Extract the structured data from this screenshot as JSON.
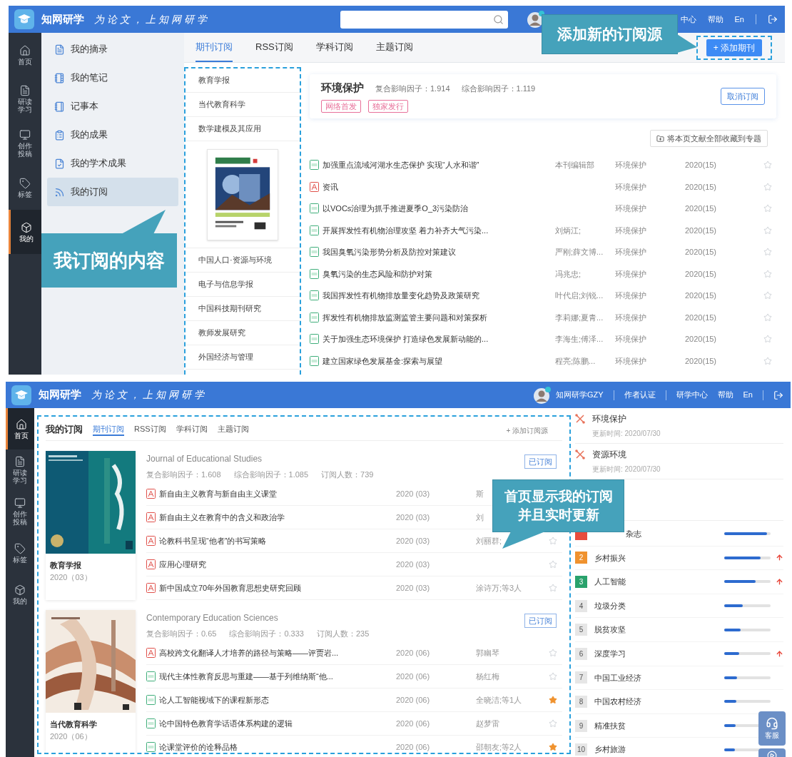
{
  "top_screen": {
    "header": {
      "brand": "知网研学",
      "slogan": "为论文，上知网研学",
      "links": [
        "中心",
        "帮助",
        "En"
      ]
    },
    "nav": [
      {
        "label": "首页",
        "selected": false
      },
      {
        "label": "研读学习",
        "selected": false
      },
      {
        "label": "创作投稿",
        "selected": false
      },
      {
        "label": "标签",
        "selected": false
      },
      {
        "label": "我的",
        "selected": true
      }
    ],
    "menu": [
      {
        "label": "我的摘录",
        "selected": false
      },
      {
        "label": "我的笔记",
        "selected": false
      },
      {
        "label": "记事本",
        "selected": false
      },
      {
        "label": "我的成果",
        "selected": false
      },
      {
        "label": "我的学术成果",
        "selected": false
      },
      {
        "label": "我的订阅",
        "selected": true
      }
    ],
    "tabs": [
      {
        "label": "期刊订阅",
        "selected": true
      },
      {
        "label": "RSS订阅",
        "selected": false
      },
      {
        "label": "学科订阅",
        "selected": false
      },
      {
        "label": "主题订阅",
        "selected": false
      }
    ],
    "add_button": "+ 添加期刊",
    "journals": [
      {
        "kind": "name",
        "name": "教育学报"
      },
      {
        "kind": "name",
        "name": "当代教育科学"
      },
      {
        "kind": "name",
        "name": "数学建模及其应用"
      },
      {
        "kind": "picture"
      },
      {
        "kind": "name",
        "name": "中国人口·资源与环境"
      },
      {
        "kind": "name",
        "name": "电子与信息学报"
      },
      {
        "kind": "name",
        "name": "中国科技期刊研究"
      },
      {
        "kind": "name",
        "name": "教师发展研究"
      },
      {
        "kind": "name",
        "name": "外国经济与管理"
      }
    ],
    "detail": {
      "title": "环境保护",
      "metrics": [
        "复合影响因子：1.914",
        "综合影响因子：1.119"
      ],
      "tags": [
        "网络首发",
        "独家发行"
      ],
      "button": "取消订阅"
    },
    "collect_button": "将本页文献全部收藏到专题",
    "articles": [
      {
        "kind": "html",
        "title": "加强重点流域河湖水生态保护 实现“人水和谐”",
        "author": "本刊编辑部",
        "journal": "环境保护",
        "issue": "2020(15)",
        "starred": false
      },
      {
        "kind": "pdf",
        "title": "资讯",
        "journal": "环境保护",
        "issue": "2020(15)",
        "starred": false
      },
      {
        "kind": "html",
        "title": "以VOCs治理为抓手推进夏季O_3污染防治",
        "journal": "环境保护",
        "issue": "2020(15)",
        "starred": false
      },
      {
        "kind": "html",
        "title": "开展挥发性有机物治理攻坚 着力补齐大气污染...",
        "author": "刘炳江;",
        "journal": "环境保护",
        "issue": "2020(15)",
        "starred": false
      },
      {
        "kind": "html",
        "title": "我国臭氧污染形势分析及防控对策建议",
        "author": "严刚;薛文博...",
        "journal": "环境保护",
        "issue": "2020(15)",
        "starred": false
      },
      {
        "kind": "html",
        "title": "臭氧污染的生态风险和防护对策",
        "author": "冯兆忠;",
        "journal": "环境保护",
        "issue": "2020(15)",
        "starred": false
      },
      {
        "kind": "html",
        "title": "我国挥发性有机物排放量变化趋势及政策研究",
        "author": "叶代启;刘锐...",
        "journal": "环境保护",
        "issue": "2020(15)",
        "starred": false
      },
      {
        "kind": "html",
        "title": "挥发性有机物排放监测监管主要问题和对策探析",
        "author": "李莉娜;夏青...",
        "journal": "环境保护",
        "issue": "2020(15)",
        "starred": false
      },
      {
        "kind": "html",
        "title": "关于加强生态环境保护 打造绿色发展新动能的...",
        "author": "李海生;傅泽...",
        "journal": "环境保护",
        "issue": "2020(15)",
        "starred": false
      },
      {
        "kind": "html",
        "title": "建立国家绿色发展基金:探索与展望",
        "author": "程亮;陈鹏...",
        "journal": "环境保护",
        "issue": "2020(15)",
        "starred": false
      }
    ],
    "callouts": [
      "添加新的订阅源",
      "我订阅的内容"
    ]
  },
  "bottom_screen": {
    "header": {
      "brand": "知网研学",
      "slogan": "为论文，上知网研学",
      "user": "知网研学GZY",
      "links": [
        "作者认证",
        "研学中心",
        "帮助",
        "En"
      ]
    },
    "nav": [
      {
        "label": "首页",
        "selected": true
      },
      {
        "label": "研读学习",
        "selected": false
      },
      {
        "label": "创作投稿",
        "selected": false
      },
      {
        "label": "标签",
        "selected": false
      },
      {
        "label": "我的",
        "selected": false
      }
    ],
    "panel": {
      "title": "我的订阅",
      "tabs": [
        {
          "label": "期刊订阅",
          "selected": true
        },
        {
          "label": "RSS订阅",
          "selected": false
        },
        {
          "label": "学科订阅",
          "selected": false
        },
        {
          "label": "主题订阅",
          "selected": false
        }
      ],
      "add_link": "+ 添加订阅源",
      "journals": [
        {
          "name": "教育学报",
          "issue": "2020（03）",
          "title": "Journal of Educational Studies",
          "metrics": [
            "复合影响因子：1.608",
            "综合影响因子：1.085",
            "订阅人数：739"
          ],
          "button": "已订阅",
          "articles": [
            {
              "kind": "pdf",
              "title": "新自由主义教育与新自由主义课堂",
              "issue": "2020 (03)",
              "author": "斯"
            },
            {
              "kind": "pdf",
              "title": "新自由主义在教育中的含义和政治学",
              "issue": "2020 (03)",
              "author": "刘"
            },
            {
              "kind": "pdf",
              "title": "论教科书呈现“他者”的书写策略",
              "issue": "2020 (03)",
              "author": "刘丽群;",
              "starred": false
            },
            {
              "kind": "pdf",
              "title": "应用心理研究",
              "issue": "2020 (03)",
              "starred": false
            },
            {
              "kind": "pdf",
              "title": "新中国成立70年外国教育思想史研究回顾",
              "issue": "2020 (03)",
              "author": "涂诗万;等3人",
              "starred": false
            }
          ]
        },
        {
          "name": "当代教育科学",
          "issue": "2020（06）",
          "title": "Contemporary Education Sciences",
          "metrics": [
            "复合影响因子：0.65",
            "综合影响因子：0.333",
            "订阅人数：235"
          ],
          "button": "已订阅",
          "articles": [
            {
              "kind": "pdf",
              "title": "高校跨文化翻译人才培养的路径与策略——评贾岩...",
              "issue": "2020 (06)",
              "author": "郭幽琴",
              "starred": false
            },
            {
              "kind": "html",
              "title": "现代主体性教育反思与重建——基于列维纳斯“他...",
              "issue": "2020 (06)",
              "author": "杨红梅",
              "starred": false
            },
            {
              "kind": "html",
              "title": "论人工智能视域下的课程新形态",
              "issue": "2020 (06)",
              "author": "全晓洁;等1人",
              "starred": true
            },
            {
              "kind": "html",
              "title": "论中国特色教育学话语体系构建的逻辑",
              "issue": "2020 (06)",
              "author": "赵梦雷",
              "starred": false
            },
            {
              "kind": "html",
              "title": "论课堂评价的诠释品格",
              "issue": "2020 (06)",
              "author": "邵朝友;等2人",
              "starred": true
            }
          ]
        }
      ]
    },
    "subjects": [
      {
        "name": "环境保护",
        "updated": "更新时间: 2020/07/30"
      },
      {
        "name": "资源环境",
        "updated": "更新时间: 2020/07/30"
      }
    ],
    "ranking": [
      {
        "name": "杂志",
        "color": "#e84c3d",
        "level": 0.92,
        "rising": false
      },
      {
        "rank": "2",
        "name": "乡村振兴",
        "color": "#f0922e",
        "level": 0.78,
        "rising": true
      },
      {
        "rank": "3",
        "name": "人工智能",
        "color": "#2aa26c",
        "level": 0.67,
        "rising": true
      },
      {
        "rank": "4",
        "name": "垃圾分类",
        "color": "#e6e6e6",
        "level": 0.4,
        "rising": false
      },
      {
        "rank": "5",
        "name": "脱贫攻坚",
        "color": "#e6e6e6",
        "level": 0.35,
        "rising": false
      },
      {
        "rank": "6",
        "name": "深度学习",
        "color": "#e6e6e6",
        "level": 0.33,
        "rising": true
      },
      {
        "rank": "7",
        "name": "中国工业经济",
        "color": "#e6e6e6",
        "level": 0.28,
        "rising": false
      },
      {
        "rank": "8",
        "name": "中国农村经济",
        "color": "#e6e6e6",
        "level": 0.26,
        "rising": false
      },
      {
        "rank": "9",
        "name": "精准扶贫",
        "color": "#e6e6e6",
        "level": 0.25,
        "rising": false
      },
      {
        "rank": "10",
        "name": "乡村旅游",
        "color": "#e6e6e6",
        "level": 0.23,
        "rising": false
      }
    ],
    "service_button": "客服",
    "callout": [
      "首页显示我的订阅",
      "并且实时更新"
    ]
  }
}
